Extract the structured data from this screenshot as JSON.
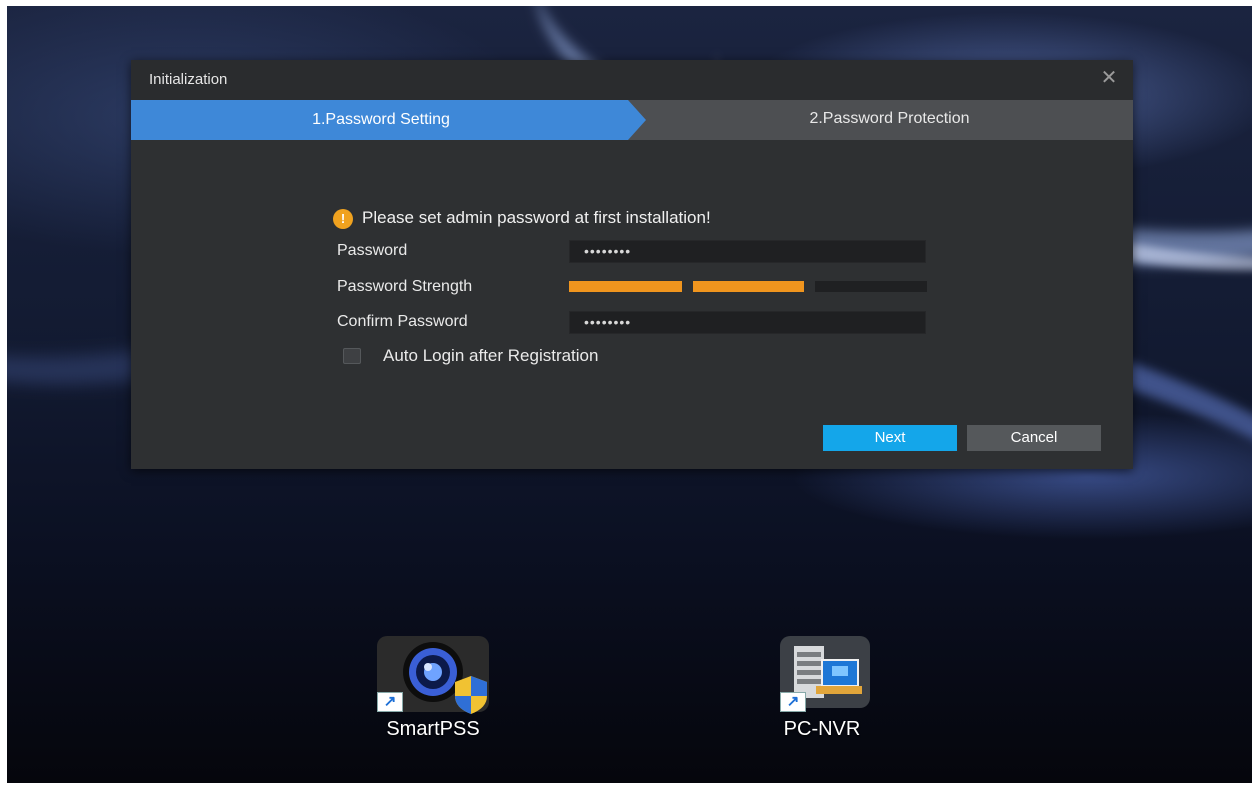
{
  "dialog": {
    "title": "Initialization",
    "close_glyph": "✕",
    "steps": [
      {
        "label": "1.Password Setting",
        "active": true
      },
      {
        "label": "2.Password Protection",
        "active": false
      }
    ],
    "notice": "Please set admin password at first installation!",
    "notice_icon_glyph": "!",
    "fields": {
      "password_label": "Password",
      "password_value": "••••••••",
      "strength_label": "Password Strength",
      "strength_level": "2 of 3 segments filled",
      "confirm_label": "Confirm Password",
      "confirm_value": "••••••••"
    },
    "auto_login_label": "Auto Login after Registration",
    "auto_login_checked": false,
    "buttons": {
      "next": "Next",
      "cancel": "Cancel"
    }
  },
  "desktop_icons": [
    {
      "label": "SmartPSS",
      "icon": "smartpss-camera-shield-icon"
    },
    {
      "label": "PC-NVR",
      "icon": "pc-nvr-server-icon"
    }
  ],
  "shortcut_glyph": "↗",
  "colors": {
    "accent_blue": "#3e88d8",
    "next_button": "#14a6ea",
    "strength_orange": "#f0951e",
    "warning_orange": "#f0a21f",
    "dialog_bg": "#2e3032"
  }
}
